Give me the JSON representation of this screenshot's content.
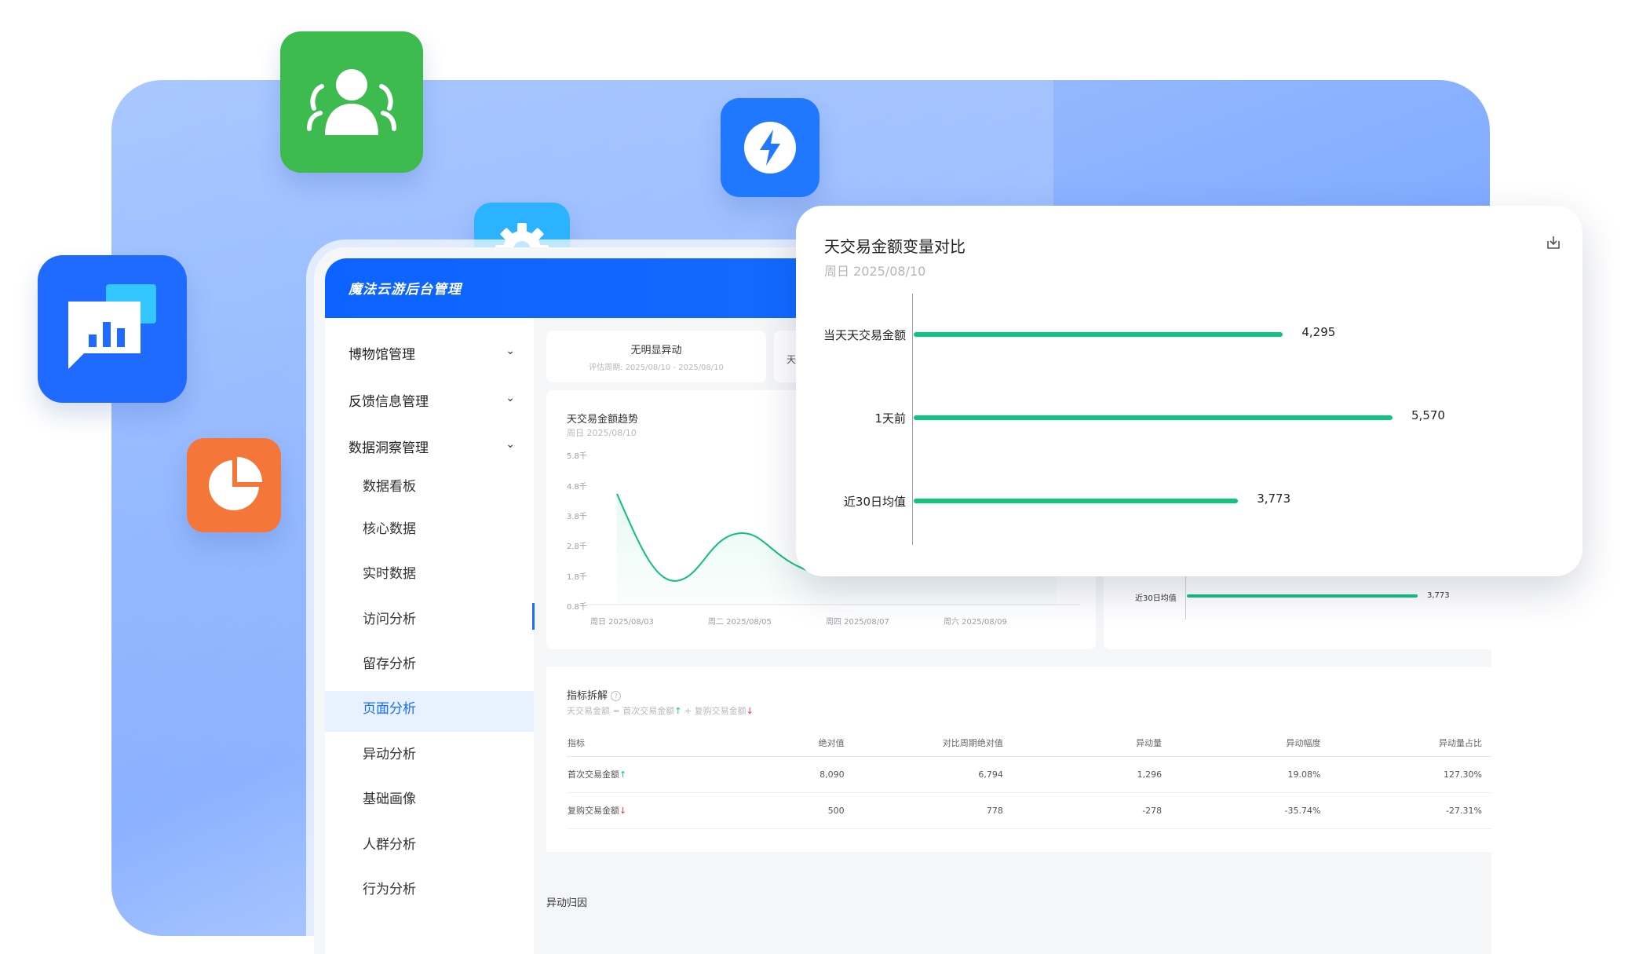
{
  "app": {
    "title": "魔法云游后台管理"
  },
  "sidebar": {
    "groups": [
      {
        "label": "博物馆管理"
      },
      {
        "label": "反馈信息管理"
      },
      {
        "label": "数据洞察管理"
      }
    ],
    "items": [
      {
        "label": "数据看板"
      },
      {
        "label": "核心数据"
      },
      {
        "label": "实时数据"
      },
      {
        "label": "访问分析"
      },
      {
        "label": "留存分析"
      },
      {
        "label": "页面分析"
      },
      {
        "label": "异动分析"
      },
      {
        "label": "基础画像"
      },
      {
        "label": "人群分析"
      },
      {
        "label": "行为分析"
      }
    ],
    "active_item": "页面分析"
  },
  "status_card": {
    "title": "无明显异动",
    "subtitle": "评估周期: 2025/08/10 - 2025/08/10",
    "next_card_fragment": "天"
  },
  "trend_card": {
    "title": "天交易金额趋势",
    "subtitle": "周日 2025/08/10",
    "y_ticks": [
      "5.8千",
      "4.8千",
      "3.8千",
      "2.8千",
      "1.8千",
      "0.8千"
    ],
    "x_ticks": [
      "周日 2025/08/03",
      "周二 2025/08/05",
      "周四 2025/08/07",
      "周六 2025/08/09"
    ]
  },
  "behind_compare": {
    "row_label": "近30日均值",
    "row_value": "3,773"
  },
  "compare_card": {
    "title": "天交易金额变量对比",
    "subtitle": "周日 2025/08/10",
    "download_icon": "download-icon"
  },
  "chart_data": {
    "type": "bar",
    "orientation": "horizontal",
    "title": "天交易金额变量对比",
    "subtitle": "周日 2025/08/10",
    "categories": [
      "当天天交易金额",
      "1天前",
      "近30日均值"
    ],
    "values": [
      4295,
      5570,
      3773
    ],
    "value_labels": [
      "4,295",
      "5,570",
      "3,773"
    ],
    "xlim": [
      0,
      5570
    ],
    "bar_color": "#0fc47c",
    "grid": false
  },
  "metrics": {
    "title": "指标拆解",
    "formula": {
      "lhs": "天交易金额",
      "eq": "=",
      "term1": "首次交易金额",
      "up": "↑",
      "plus": "+",
      "term2": "复购交易金额",
      "down": "↓"
    },
    "headers": [
      "指标",
      "绝对值",
      "对比周期绝对值",
      "异动量",
      "异动幅度",
      "异动量占比"
    ],
    "rows": [
      {
        "name": "首次交易金额",
        "arrow": "↑",
        "cells": [
          "8,090",
          "6,794",
          "1,296",
          "19.08%",
          "127.30%"
        ]
      },
      {
        "name": "复购交易金额",
        "arrow": "↓",
        "cells": [
          "500",
          "778",
          "-278",
          "-35.74%",
          "-27.31%"
        ]
      }
    ],
    "footer": "异动归因"
  },
  "colors": {
    "primary": "#1a6dff",
    "bar": "#0fc47c",
    "up": "#0fc47c",
    "down": "#e53935"
  }
}
